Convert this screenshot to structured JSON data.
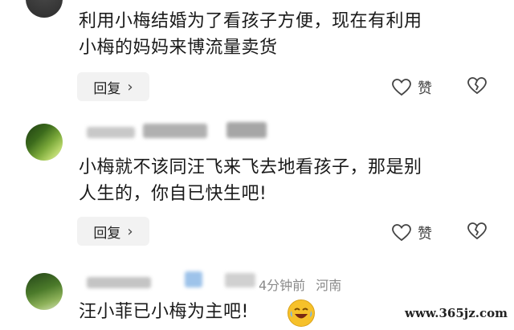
{
  "comments": [
    {
      "text_line1": "利用小梅结婚为了看孩子方便，现在有利用",
      "text_line2": "小梅的妈妈来博流量卖货",
      "reply_label": "回复",
      "like_label": "赞"
    },
    {
      "text_line1": "小梅就不该同汪飞来飞去地看孩子，那是别",
      "text_line2": "人生的，你自已快生吧!",
      "reply_label": "回复",
      "like_label": "赞"
    },
    {
      "time": "4分钟前",
      "location": "河南",
      "text": "汪小菲已小梅为主吧!"
    }
  ],
  "icons": {
    "chevron": "chevron-right-icon",
    "like": "thumb-up-icon",
    "dislike": "broken-heart-icon",
    "emoji": "laughing-crying-emoji-icon"
  },
  "watermark": "www.365jz.com"
}
